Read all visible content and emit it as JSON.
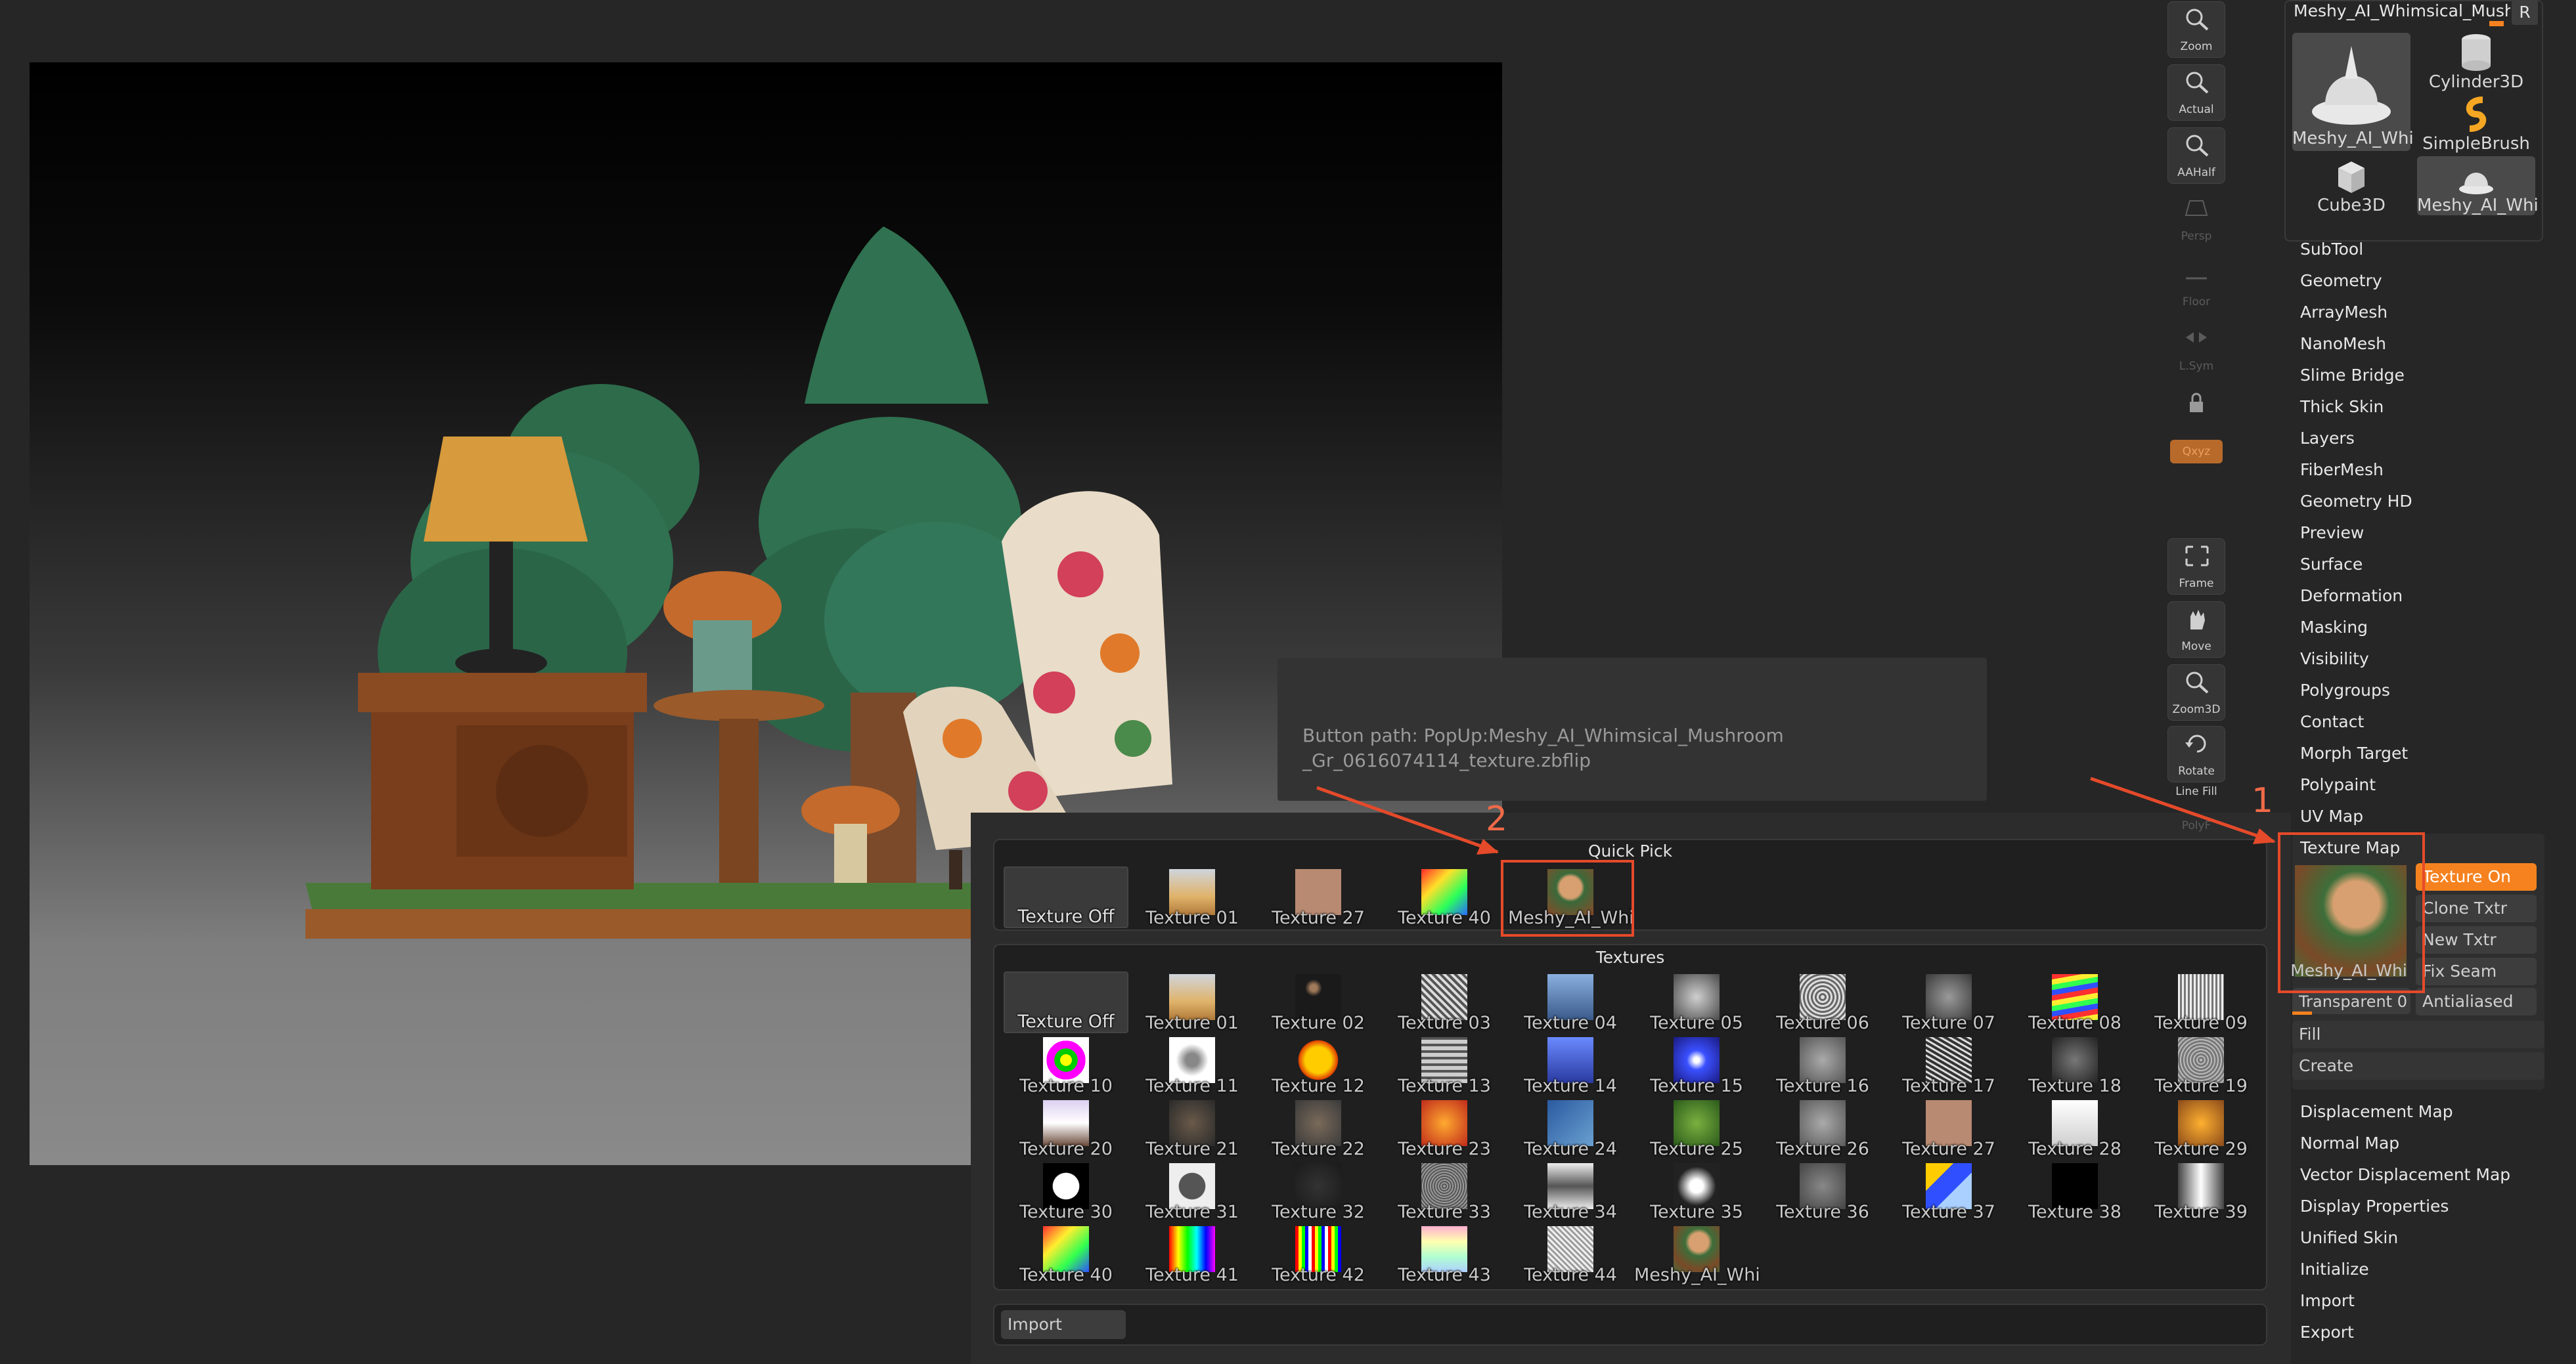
{
  "viewport": {},
  "tooltip": {
    "line1": "Button path: PopUp:Meshy_AI_Whimsical_Mushroom",
    "line2": "_Gr_0616074114_texture.zbflip"
  },
  "quick_pick": {
    "title": "Quick Pick",
    "items": [
      "Texture Off",
      "Texture 01",
      "Texture 27",
      "Texture 40",
      "Meshy_AI_Whi"
    ]
  },
  "textures": {
    "title": "Textures",
    "items": [
      "Texture Off",
      "Texture 01",
      "Texture 02",
      "Texture 03",
      "Texture 04",
      "Texture 05",
      "Texture 06",
      "Texture 07",
      "Texture 08",
      "Texture 09",
      "Texture 10",
      "Texture 11",
      "Texture 12",
      "Texture 13",
      "Texture 14",
      "Texture 15",
      "Texture 16",
      "Texture 17",
      "Texture 18",
      "Texture 19",
      "Texture 20",
      "Texture 21",
      "Texture 22",
      "Texture 23",
      "Texture 24",
      "Texture 25",
      "Texture 26",
      "Texture 27",
      "Texture 28",
      "Texture 29",
      "Texture 30",
      "Texture 31",
      "Texture 32",
      "Texture 33",
      "Texture 34",
      "Texture 35",
      "Texture 36",
      "Texture 37",
      "Texture 38",
      "Texture 39",
      "Texture 40",
      "Texture 41",
      "Texture 42",
      "Texture 43",
      "Texture 44",
      "Meshy_AI_Whi"
    ]
  },
  "import_button": "Import",
  "toolbar": {
    "zoom": "Zoom",
    "actual": "Actual",
    "aahalf": "AAHalf",
    "persp": "Persp",
    "floor": "Floor",
    "lsym": "L.Sym",
    "qxyz": "Qxyz",
    "frame": "Frame",
    "move": "Move",
    "zoom3d": "Zoom3D",
    "rotate": "Rotate",
    "line_fill": "Line Fill",
    "polyf": "PolyF"
  },
  "tool_palette": {
    "current_tool": "Meshy_AI_Whimsical_Mushro",
    "r_button": "R",
    "tools": [
      "Meshy_AI_Whi",
      "Cylinder3D",
      "SimpleBrush",
      "Cube3D",
      "Meshy_AI_Whi"
    ]
  },
  "menu": {
    "top": [
      "SubTool",
      "Geometry",
      "ArrayMesh",
      "NanoMesh",
      "Slime Bridge",
      "Thick Skin",
      "Layers",
      "FiberMesh",
      "Geometry HD",
      "Preview",
      "Surface",
      "Deformation",
      "Masking",
      "Visibility",
      "Polygroups",
      "Contact",
      "Morph Target",
      "Polypaint",
      "UV Map"
    ],
    "texture_map": "Texture Map",
    "bottom": [
      "Displacement Map",
      "Normal Map",
      "Vector Displacement Map",
      "Display Properties",
      "Unified Skin",
      "Initialize",
      "Import",
      "Export"
    ]
  },
  "texture_map": {
    "thumb_label": "Meshy_AI_Whi",
    "texture_on": "Texture On",
    "clone_txtr": "Clone Txtr",
    "new_txtr": "New Txtr",
    "fix_seam": "Fix Seam",
    "transparent": "Transparent 0",
    "antialiased": "Antialiased",
    "fill": "Fill",
    "create": "Create"
  },
  "colors": {
    "accent": "#f5821f",
    "annotation": "#e54a2a"
  },
  "annotations": {
    "one": "1",
    "two": "2"
  }
}
